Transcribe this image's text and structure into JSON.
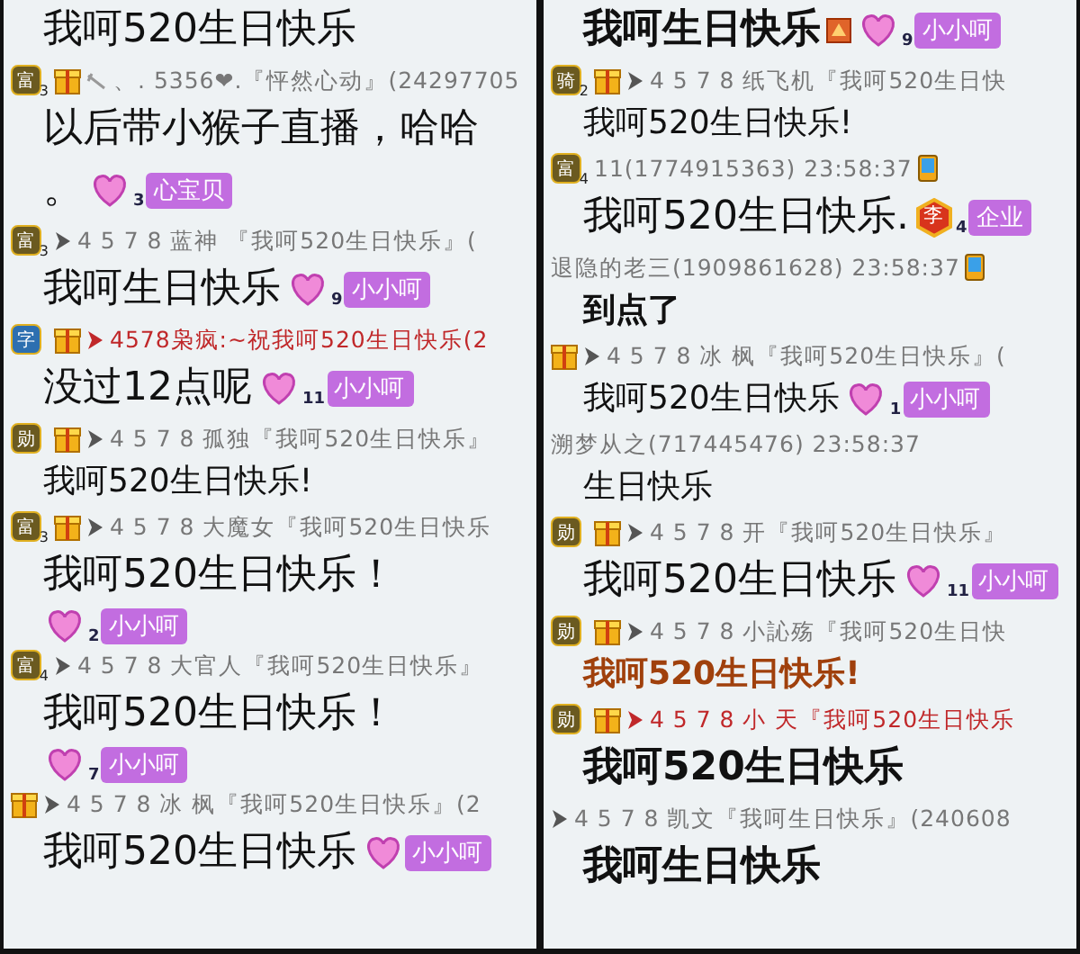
{
  "columns": [
    {
      "lines": [
        {
          "kind": "message",
          "text": "我呵520生日快乐",
          "large": true,
          "bold": false,
          "color": "#111111"
        },
        {
          "kind": "sender",
          "badges": [
            {
              "kind": "rank",
              "char": "富",
              "level": "3"
            },
            {
              "kind": "gift"
            }
          ],
          "arrow": {
            "kind": "needle"
          },
          "text": "、. 5356❤.『怦然心动』(24297705",
          "color": "#777777"
        },
        {
          "kind": "message",
          "text": "以后带小猴子直播，哈哈",
          "large": true,
          "bold": false,
          "color": "#111111"
        },
        {
          "kind": "message",
          "text": "。",
          "large": true,
          "bold": false,
          "color": "#111111",
          "tag": {
            "level": "3",
            "name": "心宝贝"
          }
        },
        {
          "kind": "sender",
          "badges": [
            {
              "kind": "rank",
              "char": "富",
              "level": "3"
            }
          ],
          "arrow": {
            "kind": "triangle"
          },
          "text": "4 5 7 8 蓝神 『我呵520生日快乐』(",
          "color": "#777777"
        },
        {
          "kind": "message",
          "text": "我呵生日快乐",
          "large": true,
          "bold": false,
          "color": "#111111",
          "tag": {
            "level": "9",
            "name": "小小呵"
          }
        },
        {
          "kind": "sender",
          "badges": [
            {
              "kind": "word",
              "char": "字"
            },
            {
              "kind": "gift"
            }
          ],
          "arrow": {
            "kind": "triangle"
          },
          "text": "4578枭疯:~祝我呵520生日快乐(2",
          "color": "#c0282a"
        },
        {
          "kind": "message",
          "text": "没过12点呢",
          "large": true,
          "bold": false,
          "color": "#111111",
          "tag": {
            "level": "11",
            "name": "小小呵"
          }
        },
        {
          "kind": "sender",
          "badges": [
            {
              "kind": "rank",
              "char": "勋"
            },
            {
              "kind": "gift"
            }
          ],
          "arrow": {
            "kind": "triangle"
          },
          "text": "4 5 7 8 孤独『我呵520生日快乐』",
          "color": "#777777"
        },
        {
          "kind": "message",
          "text": "我呵520生日快乐!",
          "large": false,
          "bold": false,
          "color": "#111111"
        },
        {
          "kind": "sender",
          "badges": [
            {
              "kind": "rank",
              "char": "富",
              "level": "3"
            },
            {
              "kind": "gift"
            }
          ],
          "arrow": {
            "kind": "triangle"
          },
          "text": "4 5 7 8 大魔女『我呵520生日快乐",
          "color": "#777777"
        },
        {
          "kind": "message",
          "text": "我呵520生日快乐！",
          "large": true,
          "bold": false,
          "color": "#111111"
        },
        {
          "kind": "tag",
          "tag": {
            "level": "2",
            "name": "小小呵"
          }
        },
        {
          "kind": "sender",
          "badges": [
            {
              "kind": "rank",
              "char": "富",
              "level": "4"
            }
          ],
          "arrow": {
            "kind": "triangle"
          },
          "text": "4 5 7 8 大官人『我呵520生日快乐』",
          "color": "#777777"
        },
        {
          "kind": "message",
          "text": "我呵520生日快乐！",
          "large": true,
          "bold": false,
          "color": "#111111"
        },
        {
          "kind": "tag",
          "tag": {
            "level": "7",
            "name": "小小呵"
          }
        },
        {
          "kind": "sender",
          "badges": [
            {
              "kind": "gift"
            }
          ],
          "arrow": {
            "kind": "triangle"
          },
          "text": "4 5 7 8 冰 枫『我呵520生日快乐』(2",
          "color": "#777777"
        },
        {
          "kind": "message",
          "text": "我呵520生日快乐",
          "large": true,
          "bold": false,
          "color": "#111111",
          "tag": {
            "name": "小小呵"
          }
        }
      ]
    },
    {
      "lines": [
        {
          "kind": "message",
          "text": "我呵生日快乐",
          "large": true,
          "bold": true,
          "color": "#111111",
          "scene": true,
          "tag": {
            "level": "9",
            "name": "小小呵"
          }
        },
        {
          "kind": "sender",
          "badges": [
            {
              "kind": "rank",
              "char": "骑",
              "level": "2"
            },
            {
              "kind": "gift"
            }
          ],
          "arrow": {
            "kind": "triangle"
          },
          "text": "4 5 7 8 纸飞机『我呵520生日快",
          "color": "#777777"
        },
        {
          "kind": "message",
          "text": "我呵520生日快乐!",
          "large": false,
          "bold": false,
          "color": "#111111"
        },
        {
          "kind": "sender",
          "badges": [
            {
              "kind": "rank",
              "char": "富",
              "level": "4"
            }
          ],
          "text": "11(1774915363) 23:58:37",
          "color": "#777777",
          "phone": true
        },
        {
          "kind": "message",
          "text": "我呵520生日快乐.",
          "large": true,
          "bold": false,
          "color": "#111111",
          "tag": {
            "kind": "hex",
            "char": "李",
            "level": "4",
            "name": "企业"
          }
        },
        {
          "kind": "sender",
          "text": "退隐的老三(1909861628) 23:58:37",
          "color": "#777777",
          "phone": true
        },
        {
          "kind": "message",
          "text": "到点了",
          "large": false,
          "bold": true,
          "color": "#111111"
        },
        {
          "kind": "sender",
          "badges": [
            {
              "kind": "gift"
            }
          ],
          "arrow": {
            "kind": "triangle"
          },
          "text": "4 5 7 8 冰 枫『我呵520生日快乐』(",
          "color": "#777777"
        },
        {
          "kind": "message",
          "text": "我呵520生日快乐",
          "large": false,
          "bold": false,
          "color": "#111111",
          "tag": {
            "level": "1",
            "name": "小小呵"
          }
        },
        {
          "kind": "sender",
          "text": "溯梦从之(717445476) 23:58:37",
          "color": "#777777",
          "phone": false
        },
        {
          "kind": "message",
          "text": "生日快乐",
          "large": false,
          "bold": false,
          "color": "#111111"
        },
        {
          "kind": "sender",
          "badges": [
            {
              "kind": "rank",
              "char": "勋"
            },
            {
              "kind": "gift"
            }
          ],
          "arrow": {
            "kind": "triangle"
          },
          "text": "4 5 7 8 开『我呵520生日快乐』",
          "color": "#777777"
        },
        {
          "kind": "message",
          "text": "我呵520生日快乐",
          "large": true,
          "bold": false,
          "color": "#111111",
          "tag": {
            "level": "11",
            "name": "小小呵"
          }
        },
        {
          "kind": "sender",
          "badges": [
            {
              "kind": "rank",
              "char": "勋"
            },
            {
              "kind": "gift"
            }
          ],
          "arrow": {
            "kind": "triangle"
          },
          "text": "4 5 7 8 小訫殇『我呵520生日快",
          "color": "#777777"
        },
        {
          "kind": "message",
          "text": "我呵520生日快乐!",
          "large": false,
          "bold": true,
          "color": "#a0400c"
        },
        {
          "kind": "sender",
          "badges": [
            {
              "kind": "rank",
              "char": "勋"
            },
            {
              "kind": "gift"
            }
          ],
          "arrow": {
            "kind": "triangle"
          },
          "text": "4 5 7 8 小 天『我呵520生日快乐",
          "color": "#c0282a"
        },
        {
          "kind": "message",
          "text": "我呵520生日快乐",
          "large": true,
          "bold": true,
          "color": "#111111"
        },
        {
          "kind": "sender",
          "arrow": {
            "kind": "triangle"
          },
          "text": "4 5 7 8 凯文『我呵生日快乐』(240608",
          "color": "#777777"
        },
        {
          "kind": "message",
          "text": "我呵生日快乐",
          "large": true,
          "bold": true,
          "color": "#111111"
        }
      ]
    }
  ]
}
